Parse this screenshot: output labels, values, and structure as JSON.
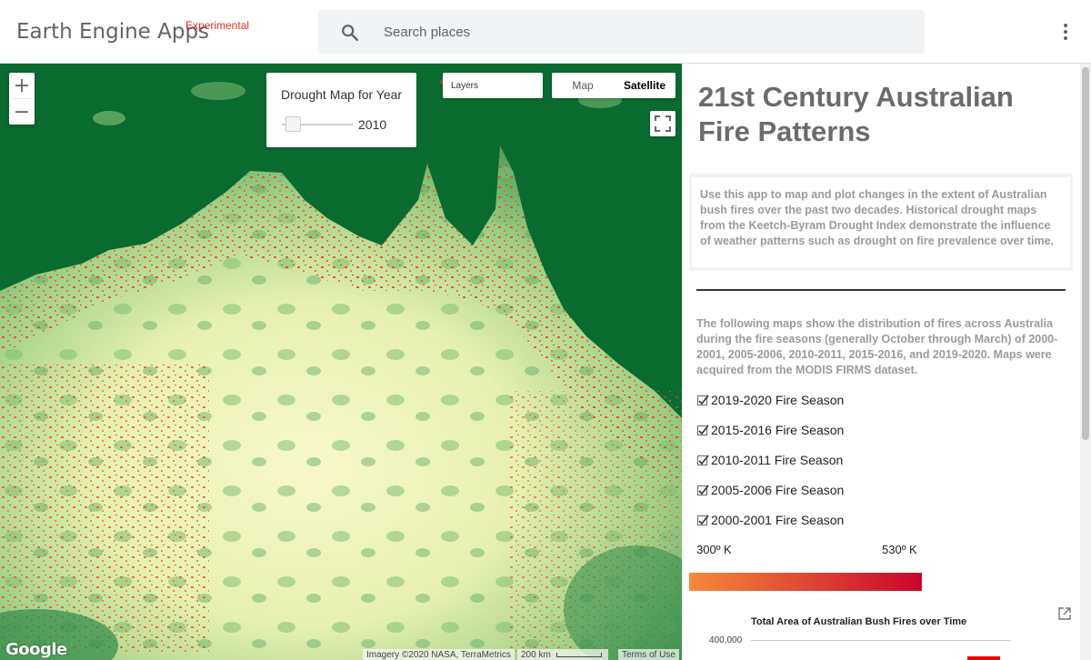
{
  "header": {
    "brand": "Earth Engine Apps",
    "badge": "Experimental",
    "search_placeholder": "Search places"
  },
  "map": {
    "panel_title": "Drought Map for Year",
    "slider_value": "2010",
    "layers_label": "Layers",
    "map_type_options": [
      "Map",
      "Satellite"
    ],
    "map_type_selected": "Satellite",
    "google_logo": "Google",
    "attribution": "Imagery ©2020 NASA, TerraMetrics",
    "scale": "200 km",
    "terms": "Terms of Use"
  },
  "side": {
    "title": "21st Century Australian Fire Patterns",
    "intro": "Use this app to map and plot changes in the extent of Australian bush fires over the past two decades. Historical drought maps from the Keetch-Byram Drought Index demonstrate the influence of weather patterns such as drought on fire prevalence over time.",
    "description": "The following maps show the distribution of fires across Australia during the fire seasons (generally October through March) of 2000-2001, 2005-2006, 2010-2011, 2015-2016, and 2019-2020. Maps were acquired from the MODIS FIRMS dataset.",
    "checkboxes": [
      {
        "label": "2019-2020 Fire Season",
        "checked": true
      },
      {
        "label": "2015-2016 Fire Season",
        "checked": true
      },
      {
        "label": "2010-2011 Fire Season",
        "checked": true
      },
      {
        "label": "2005-2006 Fire Season",
        "checked": true
      },
      {
        "label": "2000-2001 Fire Season",
        "checked": true
      }
    ],
    "legend_min": "300º K",
    "legend_max": "530º K",
    "legend_colors": [
      "#f5893b",
      "#c8062b"
    ],
    "chart_title": "Total Area of Australian Bush Fires over Time",
    "chart_ytick": "400,000"
  },
  "colors": {
    "ocean": "#0a6b30",
    "fire": "#e8451f",
    "accent": "#d93025"
  }
}
